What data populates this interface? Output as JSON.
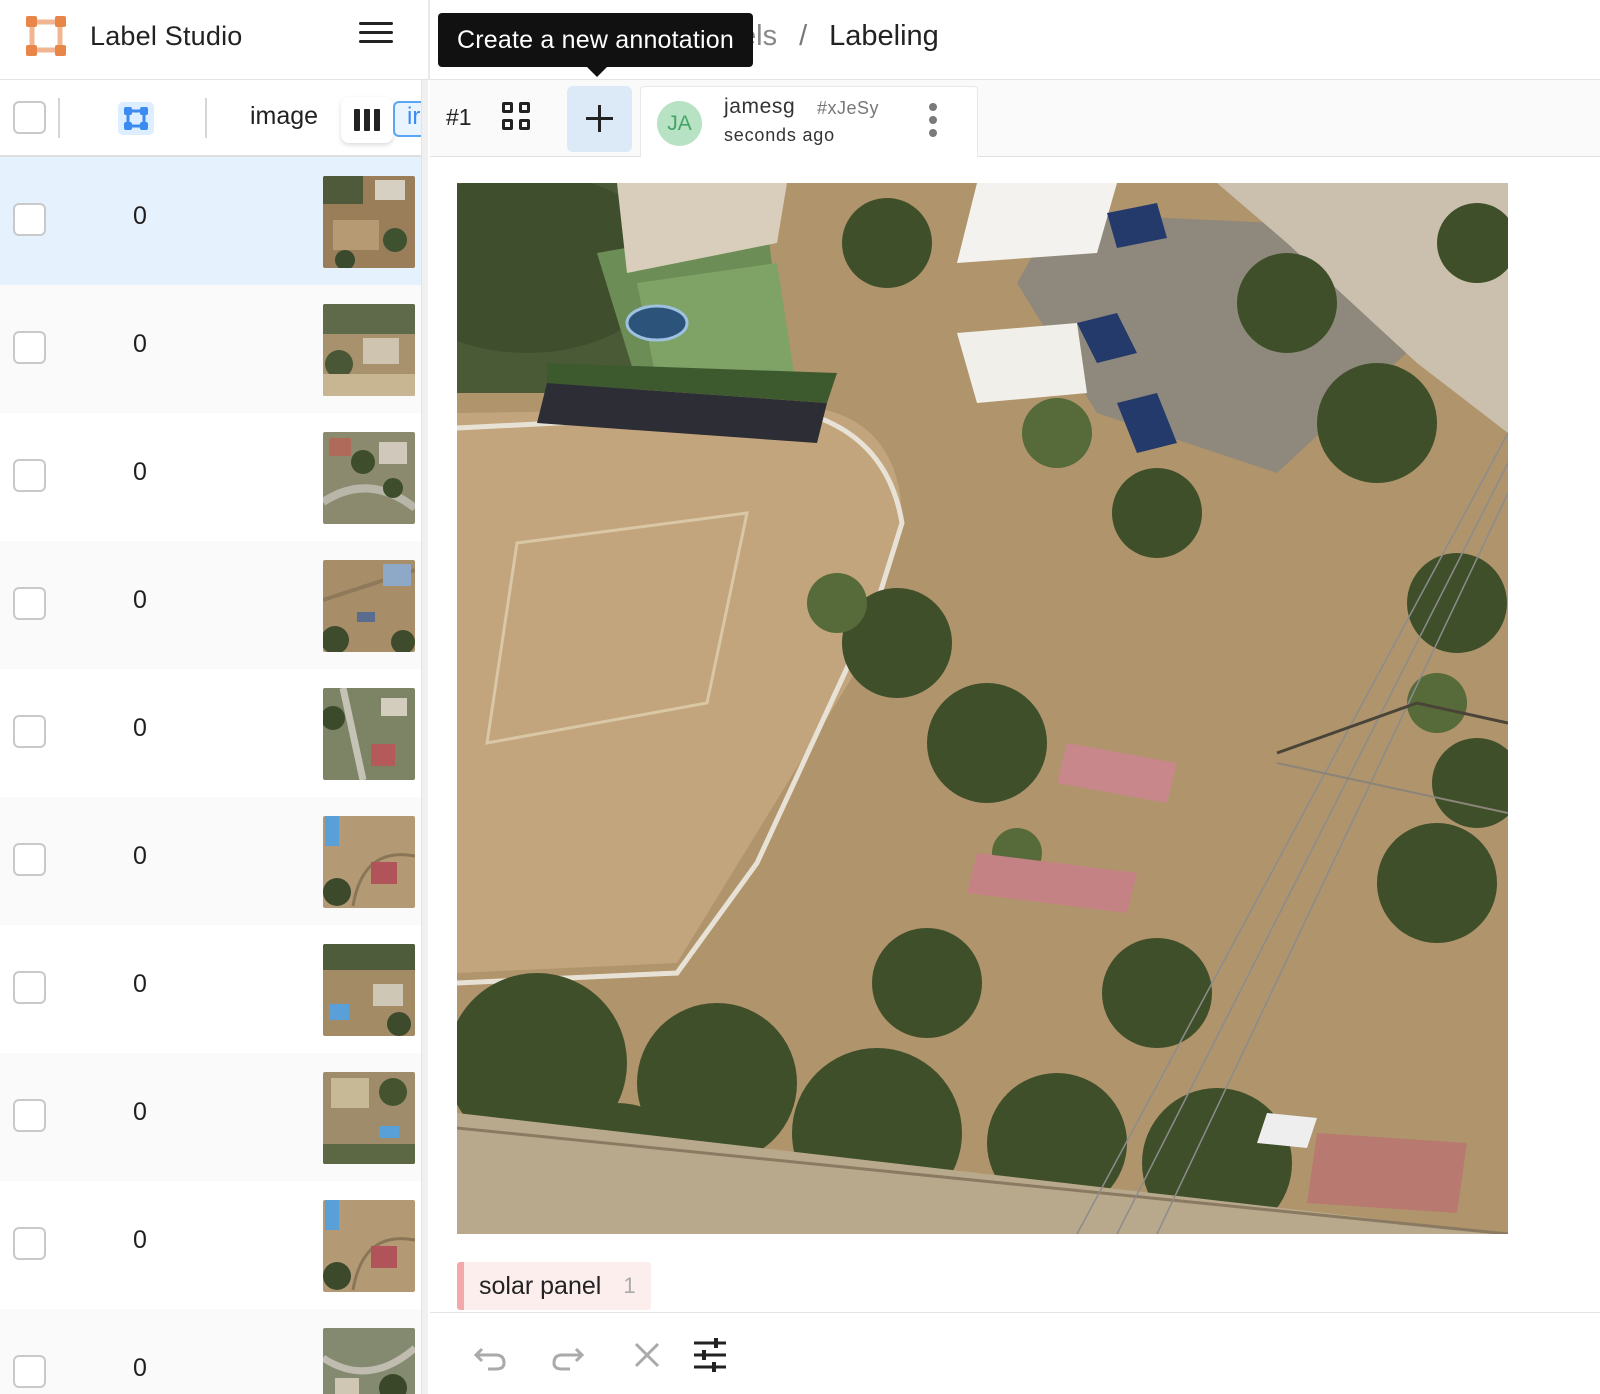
{
  "app": {
    "name": "Label Studio"
  },
  "breadcrumb": {
    "previous_fragment": "els",
    "separator": "/",
    "current": "Labeling"
  },
  "tooltip": {
    "text": "Create a new annotation"
  },
  "sidebar": {
    "header": {
      "column_label": "image",
      "truncated_field": "ir",
      "icons": [
        "region-icon",
        "columns-icon"
      ]
    },
    "rows": [
      {
        "count": "0",
        "selected": true,
        "thumb": "aerial-thumbnail"
      },
      {
        "count": "0",
        "selected": false,
        "thumb": "aerial-thumbnail"
      },
      {
        "count": "0",
        "selected": false,
        "thumb": "aerial-thumbnail"
      },
      {
        "count": "0",
        "selected": false,
        "thumb": "aerial-thumbnail"
      },
      {
        "count": "0",
        "selected": false,
        "thumb": "aerial-thumbnail"
      },
      {
        "count": "0",
        "selected": false,
        "thumb": "aerial-thumbnail"
      },
      {
        "count": "0",
        "selected": false,
        "thumb": "aerial-thumbnail"
      },
      {
        "count": "0",
        "selected": false,
        "thumb": "aerial-thumbnail"
      },
      {
        "count": "0",
        "selected": false,
        "thumb": "aerial-thumbnail"
      },
      {
        "count": "0",
        "selected": false,
        "thumb": "aerial-thumbnail"
      }
    ]
  },
  "annotation_bar": {
    "task_id": "#1",
    "icons": [
      "grid-icon",
      "plus-icon",
      "more-vertical-icon"
    ],
    "annotation": {
      "initials": "JA",
      "user": "jamesg",
      "hash": "#xJeSy",
      "time": "seconds ago"
    }
  },
  "labels": [
    {
      "name": "solar panel",
      "count": "1",
      "color": "#f3a9a9"
    }
  ],
  "bottom_toolbar": {
    "icons": [
      "undo-icon",
      "redo-icon",
      "close-icon",
      "settings-sliders-icon"
    ]
  },
  "colors": {
    "accent_blue": "#3b8bf0",
    "selected_row": "#e5f1fd",
    "logo_orange": "#e8864a",
    "avatar_green": "#b7e2c4",
    "label_pink": "#f3a9a9"
  }
}
